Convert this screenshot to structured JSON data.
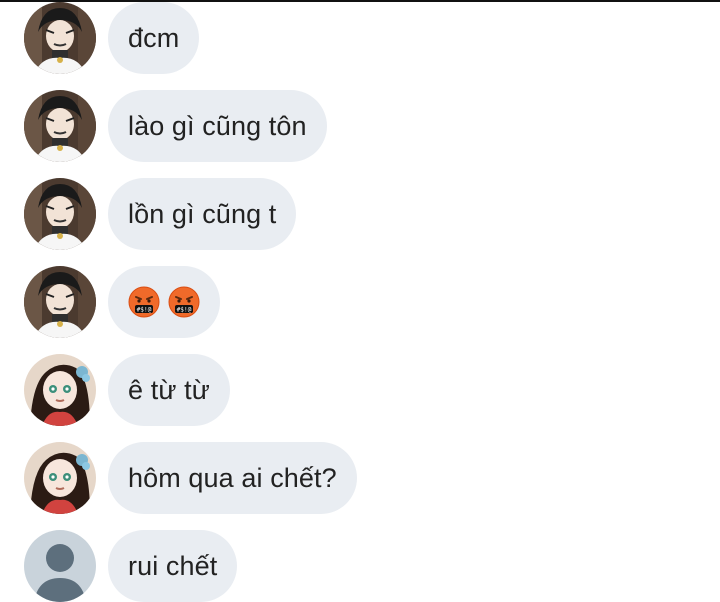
{
  "messages": [
    {
      "avatar": "male-avatar-icon",
      "text": "đcm"
    },
    {
      "avatar": "male-avatar-icon",
      "text": "lào gì cũng tôn"
    },
    {
      "avatar": "male-avatar-icon",
      "text": "lồn gì cũng t"
    },
    {
      "avatar": "male-avatar-icon",
      "emojis": [
        "cursing-face-emoji",
        "cursing-face-emoji"
      ]
    },
    {
      "avatar": "female-avatar-icon",
      "text": "ê từ từ"
    },
    {
      "avatar": "female-avatar-icon",
      "text": "hôm qua ai chết?"
    },
    {
      "avatar": "default-user-avatar-icon",
      "text": "rui chết"
    }
  ],
  "colors": {
    "bubble": "#e9edf2",
    "text": "#222222",
    "background": "#ffffff"
  }
}
